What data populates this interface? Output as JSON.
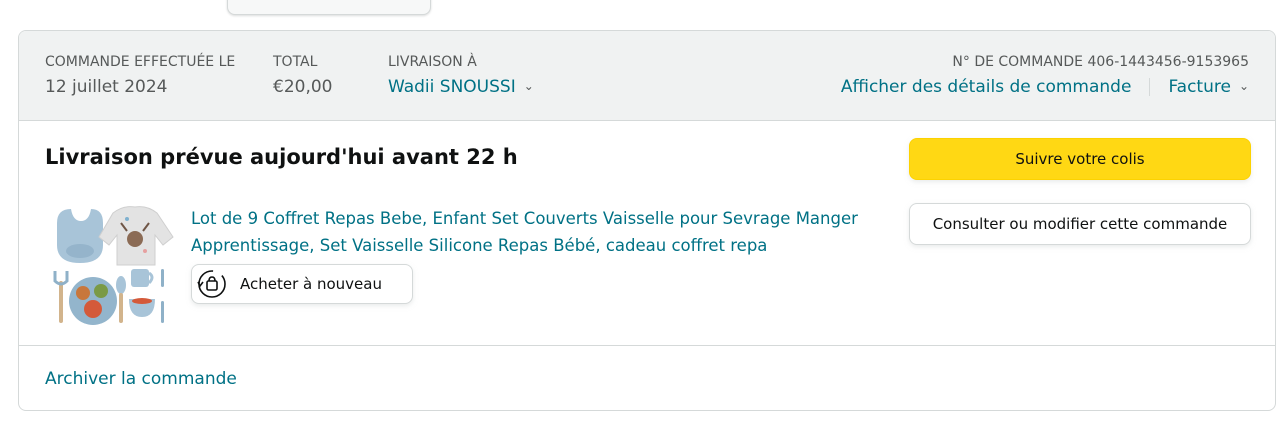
{
  "order": {
    "placed_label": "COMMANDE EFFECTUÉE LE",
    "placed_date": "12 juillet 2024",
    "total_label": "TOTAL",
    "total_value": "€20,00",
    "ship_label": "LIVRAISON À",
    "ship_name": "Wadii SNOUSSI",
    "order_number": "N° DE COMMANDE 406-1443456-9153965",
    "details_link": "Afficher des détails de commande",
    "invoice_link": "Facture"
  },
  "shipment": {
    "title": "Livraison prévue aujourd'hui avant 22 h",
    "track_button": "Suivre votre colis",
    "manage_button": "Consulter ou modifier cette commande"
  },
  "item": {
    "title": "Lot de 9 Coffret Repas Bebe, Enfant Set Couverts Vaisselle pour Sevrage Manger Apprentissage, Set Vaisselle Silicone Repas Bébé, cadeau coffret repa",
    "buy_again": "Acheter à nouveau",
    "image_icon": "baby-tableware-set-image"
  },
  "footer": {
    "archive_link": "Archiver la commande"
  },
  "colors": {
    "link": "#007185",
    "primary_button": "#FFD814",
    "header_bg": "#F0F2F2"
  }
}
